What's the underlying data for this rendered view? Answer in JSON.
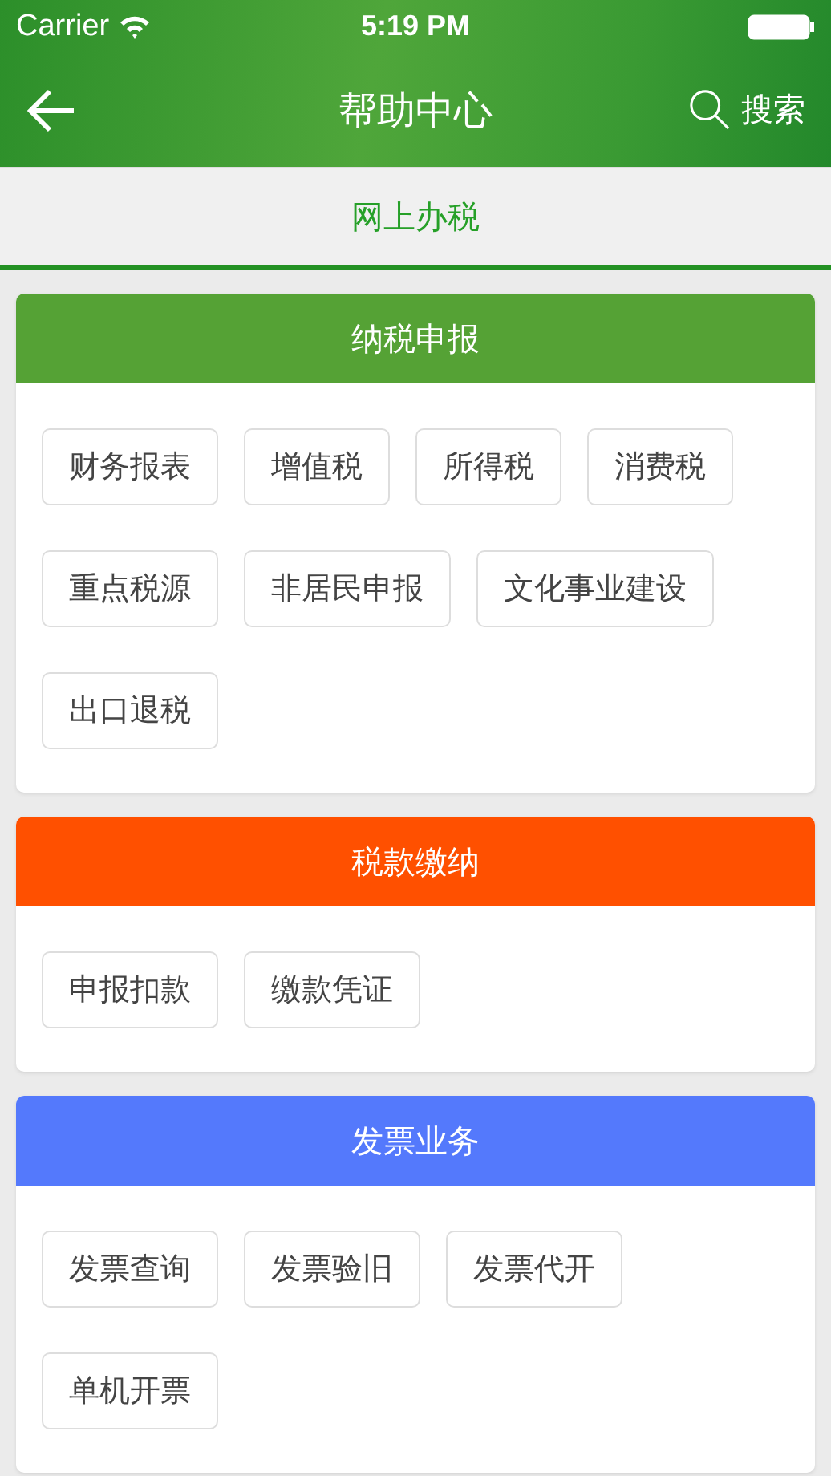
{
  "status_bar": {
    "carrier": "Carrier",
    "time": "5:19 PM"
  },
  "nav": {
    "title": "帮助中心",
    "search": "搜索"
  },
  "tabs": [
    {
      "label": "网上办税",
      "selected": true
    }
  ],
  "sections": [
    {
      "title": "纳税申报",
      "color": "#55a235",
      "items": [
        "财务报表",
        "增值税",
        "所得税",
        "消费税",
        "重点税源",
        "非居民申报",
        "文化事业建设",
        "出口退税"
      ]
    },
    {
      "title": "税款缴纳",
      "color": "#ff5000",
      "items": [
        "申报扣款",
        "缴款凭证"
      ]
    },
    {
      "title": "发票业务",
      "color": "#5479fc",
      "items": [
        "发票查询",
        "发票验旧",
        "发票代开",
        "单机开票"
      ]
    }
  ]
}
